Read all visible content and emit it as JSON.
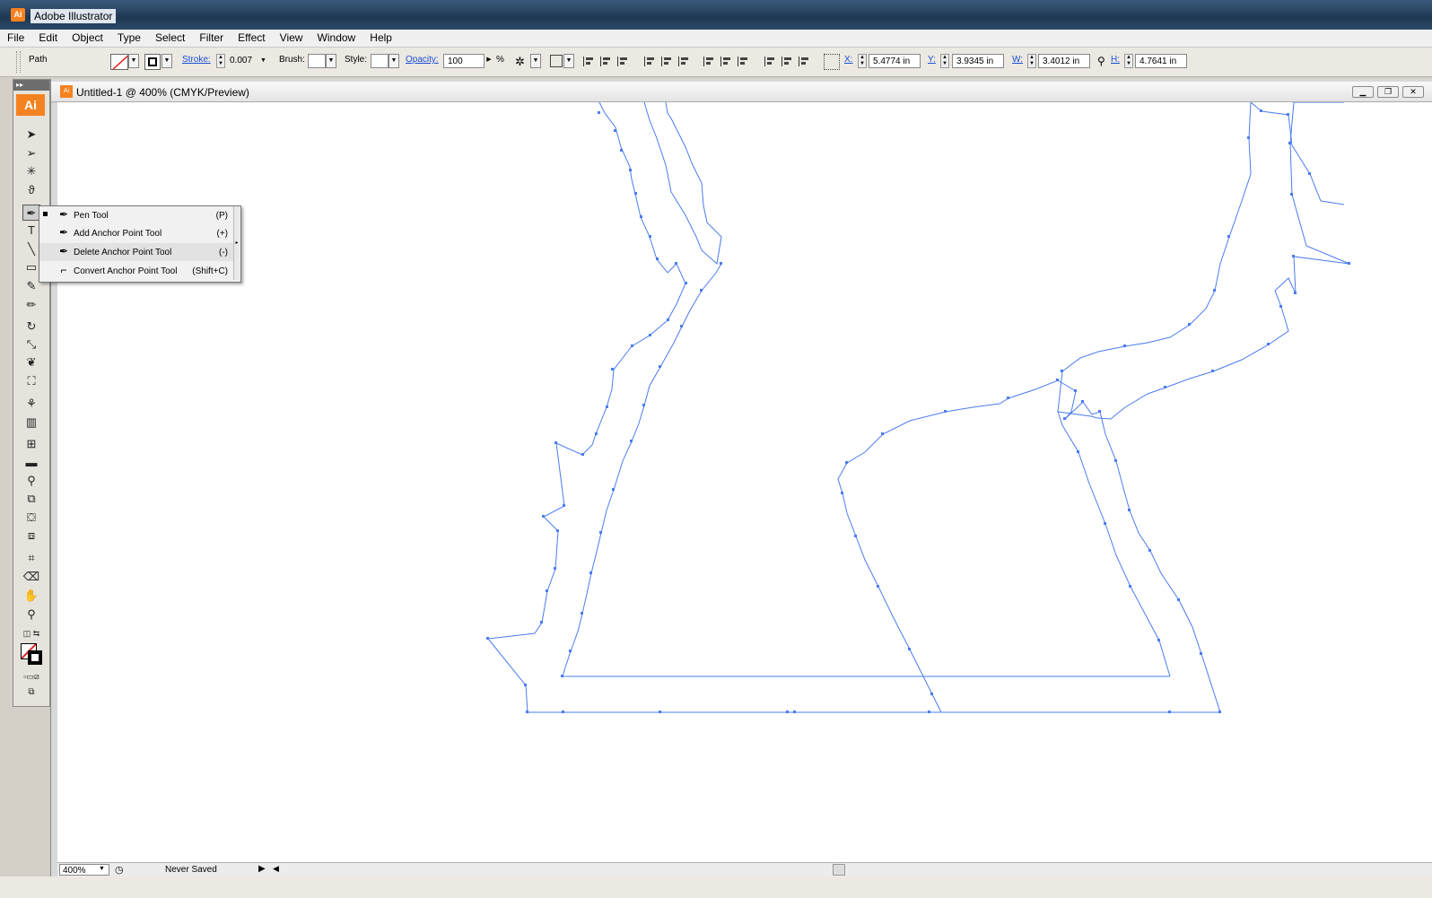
{
  "app": {
    "title": "Adobe Illustrator",
    "logo": "Ai"
  },
  "menu": [
    "File",
    "Edit",
    "Object",
    "Type",
    "Select",
    "Filter",
    "Effect",
    "View",
    "Window",
    "Help"
  ],
  "control": {
    "selection_label": "Path",
    "stroke_label": "Stroke:",
    "stroke_value": "0.007",
    "brush_label": "Brush:",
    "style_label": "Style:",
    "opacity_label": "Opacity:",
    "opacity_value": "100",
    "opacity_unit": "%",
    "x_label": "X:",
    "x_value": "5.4774 in",
    "y_label": "Y:",
    "y_value": "3.9345 in",
    "w_label": "W:",
    "w_value": "3.4012 in",
    "h_label": "H:",
    "h_value": "4.7641 in"
  },
  "toolbox": {
    "logo": "Ai",
    "collapse": "▸▸"
  },
  "document": {
    "tab_title": "Untitled-1 @ 400% (CMYK/Preview)",
    "icon": "Ai"
  },
  "flyout": [
    {
      "label": "Pen Tool",
      "shortcut": "(P)",
      "checked": true
    },
    {
      "label": "Add Anchor Point Tool",
      "shortcut": "(+)",
      "checked": false
    },
    {
      "label": "Delete Anchor Point Tool",
      "shortcut": "(-)",
      "checked": false
    },
    {
      "label": "Convert Anchor Point Tool",
      "shortcut": "(Shift+C)",
      "checked": false
    }
  ],
  "status": {
    "zoom": "400%",
    "save_state": "Never Saved"
  },
  "colors": {
    "path_stroke": "#4a7cf0",
    "accent_orange": "#f58220",
    "stroke_swatch": "#e02020"
  }
}
